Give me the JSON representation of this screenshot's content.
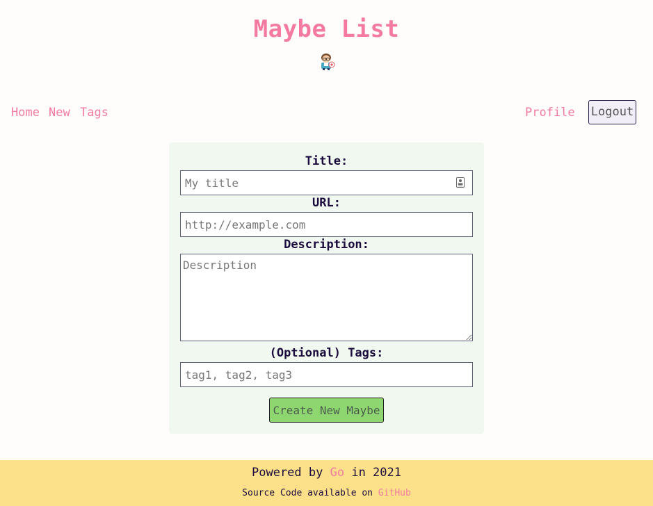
{
  "header": {
    "title": "Maybe List",
    "mascot_icon": "gopher-mascot-icon"
  },
  "nav": {
    "home": "Home",
    "new": "New",
    "tags": "Tags",
    "profile": "Profile",
    "logout": "Logout"
  },
  "form": {
    "title_label": "Title:",
    "title_placeholder": "My title",
    "title_value": "",
    "url_label": "URL:",
    "url_placeholder": "http://example.com",
    "url_value": "",
    "description_label": "Description:",
    "description_placeholder": "Description",
    "description_value": "",
    "tags_label": "(Optional) Tags:",
    "tags_placeholder": "tag1, tag2, tag3",
    "tags_value": "",
    "submit_label": "Create New Maybe"
  },
  "footer": {
    "powered_prefix": "Powered by",
    "powered_link": "Go",
    "powered_suffix": "in 2021",
    "source_prefix": "Source Code available on",
    "source_link": "GitHub"
  },
  "colors": {
    "accent_pink": "#f47aa2",
    "card_background": "#f1f8ef",
    "footer_background": "#fce08a",
    "button_green": "#8dd670",
    "text_dark": "#1a0b3d"
  }
}
